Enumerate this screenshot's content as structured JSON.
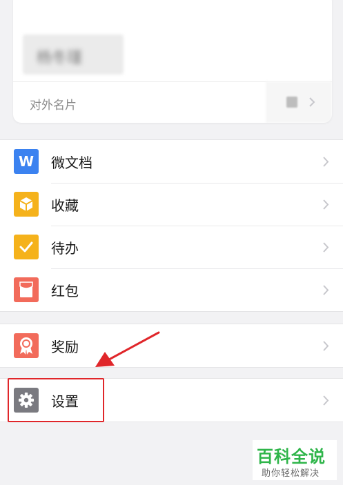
{
  "profile_card": {
    "name_blurred": "杨冬瑾",
    "footer_label": "对外名片"
  },
  "menu_group_1": {
    "items": [
      {
        "label": "微文档",
        "icon": "w-doc-icon",
        "color": "#3b82f0"
      },
      {
        "label": "收藏",
        "icon": "cube-icon",
        "color": "#f5b21b"
      },
      {
        "label": "待办",
        "icon": "checkmark-icon",
        "color": "#f5b21b"
      },
      {
        "label": "红包",
        "icon": "red-envelope-icon",
        "color": "#f26b5b"
      }
    ]
  },
  "menu_group_2": {
    "items": [
      {
        "label": "奖励",
        "icon": "award-ribbon-icon",
        "color": "#f26b5b"
      }
    ]
  },
  "menu_group_3": {
    "items": [
      {
        "label": "设置",
        "icon": "gear-icon",
        "color": "#7a7a80"
      }
    ]
  },
  "annotation": {
    "highlight_color": "#e0262a"
  },
  "watermark": {
    "title": "百科全说",
    "subtitle": "助你轻松解决",
    "color": "#2fb54a"
  }
}
